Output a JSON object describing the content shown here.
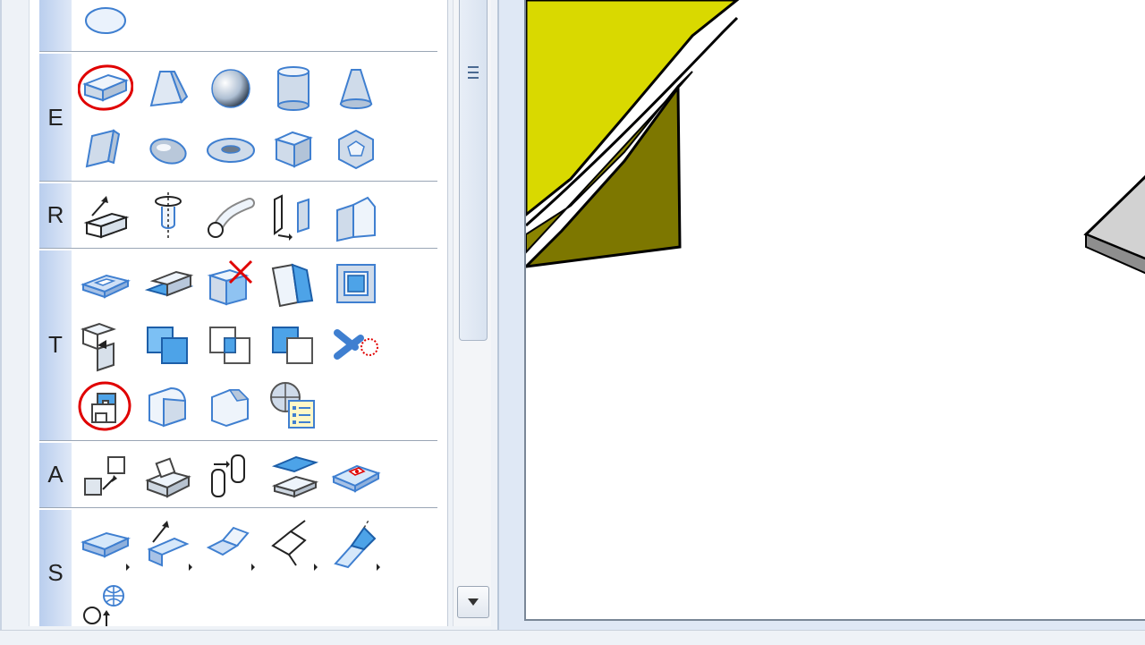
{
  "palette": {
    "groups": [
      {
        "letter": ""
      },
      {
        "letter": "E"
      },
      {
        "letter": "R"
      },
      {
        "letter": "T"
      },
      {
        "letter": "A"
      },
      {
        "letter": "S"
      }
    ]
  },
  "icons": {
    "ellipse": "ellipse-tool-icon",
    "box": "box-primitive-icon",
    "wedge": "pyramid-frustum-icon",
    "sphere": "sphere-icon",
    "cylinder": "cylinder-icon",
    "cone": "cone-icon",
    "prism": "prism-icon",
    "ellipsoid": "ellipsoid-icon",
    "torus": "torus-icon",
    "polyhedron": "polyhedron-icon",
    "dodecahedron": "dodecahedron-icon"
  },
  "colors": {
    "accent_blue": "#4a8fd8",
    "annotation_red": "#e00000",
    "model_yellow": "#d8d800",
    "model_dark": "#7a7400"
  }
}
